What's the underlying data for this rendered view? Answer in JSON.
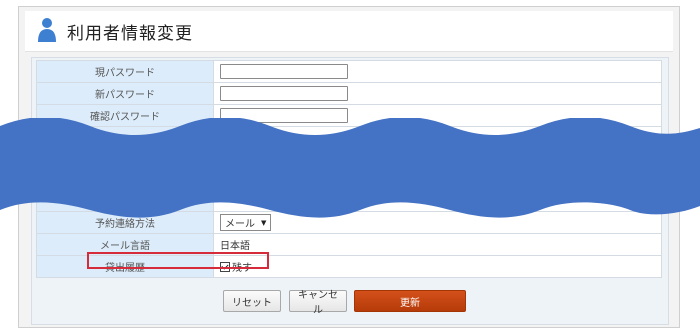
{
  "header": {
    "title": "利用者情報変更"
  },
  "form": {
    "fields": [
      {
        "label": "現パスワード",
        "value": ""
      },
      {
        "label": "新パスワード",
        "value": ""
      },
      {
        "label": "確認パスワード",
        "value": ""
      }
    ],
    "contact_method": {
      "label": "予約連絡方法",
      "selected": "メール"
    },
    "mail_language": {
      "label": "メール言語",
      "value": "日本語"
    },
    "lending_history": {
      "label": "貸出履歴",
      "checkbox_label": "残す",
      "checked": true
    }
  },
  "buttons": {
    "reset": "リセット",
    "cancel": "キャンセル",
    "update": "更新"
  },
  "colors": {
    "accent": "#c2440f",
    "wave": "#4472c4",
    "highlight": "#d62b3b",
    "label_bg": "#dcecfa"
  },
  "icons": {
    "title_icon": "person-icon",
    "select_icon": "chevron-down-icon"
  }
}
